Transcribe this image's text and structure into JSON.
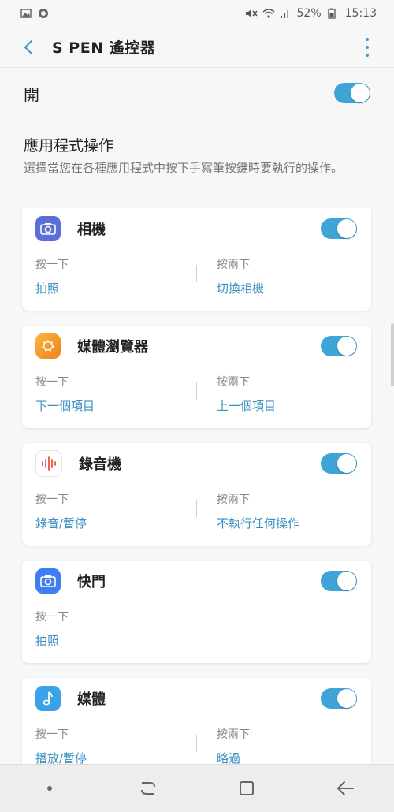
{
  "status_bar": {
    "battery": "52%",
    "time": "15:13",
    "icons": [
      "gallery-icon",
      "circle-notification-icon",
      "mute-icon",
      "wifi-icon",
      "signal-icon",
      "battery-icon"
    ]
  },
  "app_bar": {
    "title": "S PEN 遙控器",
    "back_icon": "back-arrow-icon",
    "more_icon": "more-vertical-icon"
  },
  "main_switch": {
    "label": "開",
    "enabled": true
  },
  "section": {
    "title": "應用程式操作",
    "description": "選擇當您在各種應用程式中按下手寫筆按鍵時要執行的操作。"
  },
  "apps": [
    {
      "name": "相機",
      "icon": "camera-icon",
      "icon_bg": "#5b6fd8",
      "enabled": true,
      "press_once_label": "按一下",
      "press_once_value": "拍照",
      "press_twice_label": "按兩下",
      "press_twice_value": "切換相機"
    },
    {
      "name": "媒體瀏覽器",
      "icon": "gallery-flower-icon",
      "icon_bg": "#f3a22f",
      "enabled": true,
      "press_once_label": "按一下",
      "press_once_value": "下一個項目",
      "press_twice_label": "按兩下",
      "press_twice_value": "上一個項目"
    },
    {
      "name": "錄音機",
      "icon": "voice-recorder-icon",
      "icon_bg": "#ffffff",
      "enabled": true,
      "press_once_label": "按一下",
      "press_once_value": "錄音/暫停",
      "press_twice_label": "按兩下",
      "press_twice_value": "不執行任何操作"
    },
    {
      "name": "快門",
      "icon": "shutter-camera-icon",
      "icon_bg": "#3f7ef0",
      "enabled": true,
      "press_once_label": "按一下",
      "press_once_value": "拍照",
      "press_twice_label": "",
      "press_twice_value": ""
    },
    {
      "name": "媒體",
      "icon": "music-note-icon",
      "icon_bg": "#3aa2e8",
      "enabled": true,
      "press_once_label": "按一下",
      "press_once_value": "播放/暫停",
      "press_twice_label": "按兩下",
      "press_twice_value": "略過"
    }
  ],
  "colors": {
    "accent": "#3fa5d6",
    "link": "#3a8fc0"
  },
  "nav_bar": {
    "icons": [
      "dot-icon",
      "recents-icon",
      "home-icon",
      "back-icon"
    ]
  }
}
